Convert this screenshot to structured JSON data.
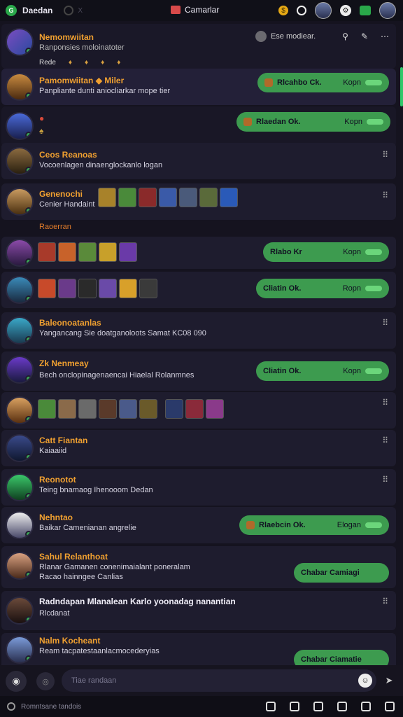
{
  "topbar": {
    "app_name": "Daedan",
    "dim_label": "X",
    "center_tab": "Camarlar"
  },
  "channel": {
    "name": "Nemomwiitan",
    "subtitle": "Ranponsies moloinatoter",
    "mod_label": "Ese modiear.",
    "emoji_labels": [
      "Rede",
      "",
      "",
      "",
      ""
    ]
  },
  "rows": [
    {
      "name": "Pamomwiitan",
      "suffix": "Miler",
      "msg": "Panpliante dunti aniocliarkar mope tier",
      "pill": {
        "label": "Rlcahbo Ck.",
        "right": "Kopn"
      }
    },
    {
      "name": "",
      "msg": "",
      "pill": {
        "label": "Rlaedan Ok.",
        "right": "Kopn"
      }
    },
    {
      "name": "Ceos Reanoas",
      "msg": "Vocoenlagen dinaenglockanlo logan",
      "dots": "⠿"
    },
    {
      "name": "Genenochi",
      "msg": "Cenier Handaint",
      "dots": "⠿"
    },
    {
      "name": "",
      "msg": "",
      "pill": {
        "label": "Rlabo Kr",
        "right": "Kopn"
      }
    },
    {
      "name": "",
      "msg": "",
      "pill": {
        "label": "Cliatin Ok.",
        "right": "Ropn"
      }
    },
    {
      "name": "Baleonoatanlas",
      "msg": "Yangancang Sie doatganoloots Samat KC08 090",
      "dots": "⠿"
    },
    {
      "name": "Zk Nenmeay",
      "msg": "Bech onclopinagenaencai Hiaelal Rolanmnes",
      "pill": {
        "label": "Cliatin Ok.",
        "right": "Kopn"
      }
    },
    {
      "name": "",
      "msg": "",
      "dots": "⠿"
    },
    {
      "name": "Catt Fiantan",
      "msg": "Kaiaaiid",
      "dots": "⠿"
    },
    {
      "name": "Reonotot",
      "msg": "Teing bnamaog Ihenooom Dedan",
      "dots": "⠿"
    },
    {
      "name": "Nehntao",
      "msg": "Baikar Camenianan angrelie",
      "pill": {
        "label": "Rlaebcin Ok.",
        "right": "Elogan"
      }
    },
    {
      "name": "Sahul Relanthoat",
      "msg": "Rlanar Gamanen conenimaialant poneralam",
      "msg2": "Racao hainngee Canlias",
      "pill": {
        "label": "Chabar Camiagi",
        "right": ""
      }
    },
    {
      "name": "Radndapan Mlanalean Karlo yoonadag nanantian",
      "msg": "Rlcdanat",
      "dots": "⠿"
    },
    {
      "name": "Nalm Kocheant",
      "msg": "Ream tacpatestaanlacmocederyias",
      "pill": {
        "label": "Chabar Ciamatie",
        "right": ""
      }
    }
  ],
  "section_label": "Raoerran",
  "composer": {
    "placeholder": "Tiae randaan"
  },
  "statusbar": {
    "text": "Romntsane tandois"
  }
}
